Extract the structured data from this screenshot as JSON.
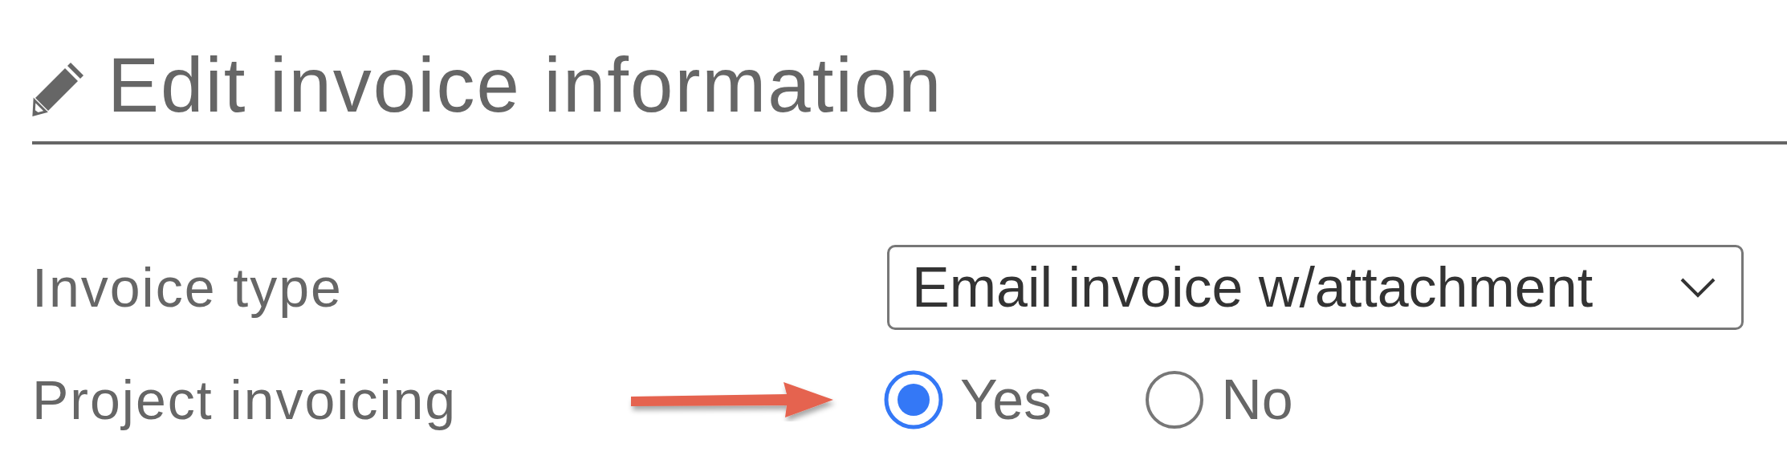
{
  "header": {
    "title": "Edit invoice information"
  },
  "fields": [
    {
      "kind": "select",
      "label": "Invoice type",
      "value": "Email invoice w/attachment"
    },
    {
      "kind": "radio",
      "label": "Project invoicing",
      "annotated": true,
      "options": [
        {
          "label": "Yes",
          "selected": true
        },
        {
          "label": "No",
          "selected": false
        }
      ]
    }
  ]
}
